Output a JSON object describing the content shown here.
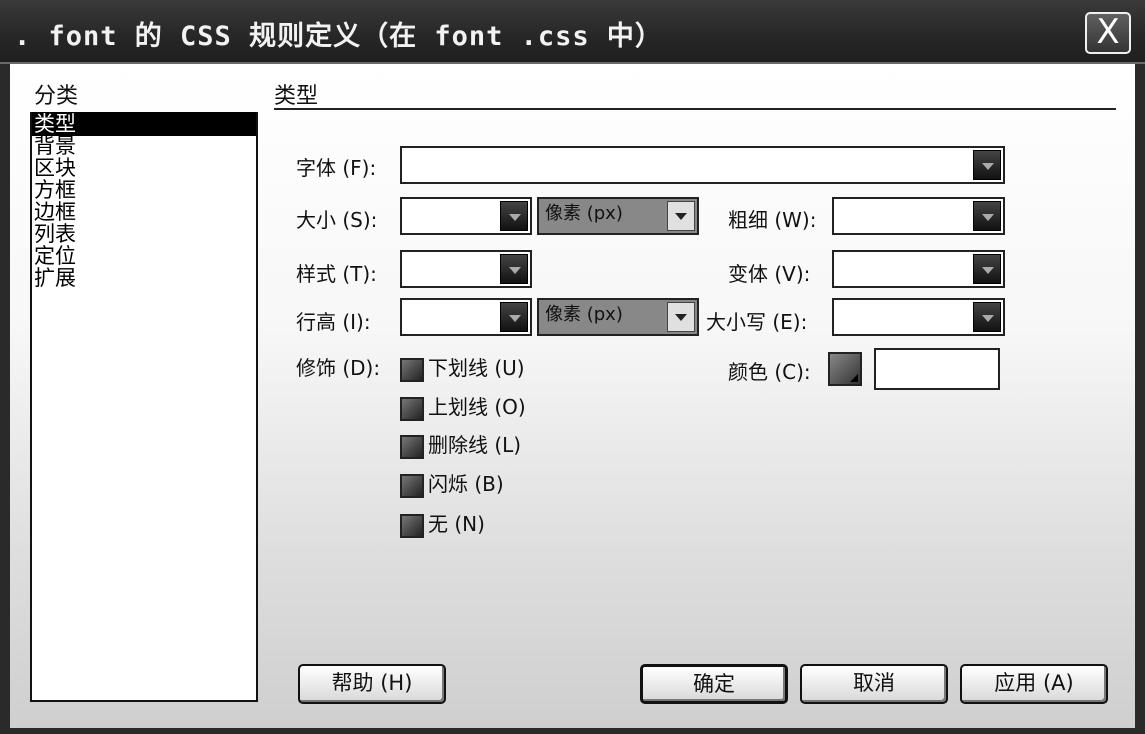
{
  "window": {
    "title": ". font 的 CSS 规则定义（在 font .css 中）",
    "close_label": "X"
  },
  "category": {
    "label": "分类",
    "items": [
      "类型",
      "背景",
      "区块",
      "方框",
      "边框",
      "列表",
      "定位",
      "扩展"
    ],
    "selected": "类型"
  },
  "section": {
    "title": "类型"
  },
  "fields": {
    "font": {
      "label": "字体 (F):",
      "value": ""
    },
    "size": {
      "label": "大小 (S):",
      "value": "",
      "unit": "像素 (px)"
    },
    "weight": {
      "label": "粗细 (W):",
      "value": ""
    },
    "style": {
      "label": "样式 (T):",
      "value": ""
    },
    "variant": {
      "label": "变体 (V):",
      "value": ""
    },
    "line_height": {
      "label": "行高 (I):",
      "value": "",
      "unit": "像素 (px)"
    },
    "case": {
      "label": "大小写 (E):",
      "value": ""
    },
    "decoration": {
      "label": "修饰 (D):"
    },
    "color": {
      "label": "颜色 (C):",
      "value": ""
    }
  },
  "decorations": [
    {
      "label": "下划线 (U)",
      "checked": false
    },
    {
      "label": "上划线 (O)",
      "checked": false
    },
    {
      "label": "删除线 (L)",
      "checked": false
    },
    {
      "label": "闪烁 (B)",
      "checked": false
    },
    {
      "label": "无 (N)",
      "checked": false
    }
  ],
  "buttons": {
    "help": "帮助 (H)",
    "ok": "确定",
    "cancel": "取消",
    "apply": "应用 (A)"
  }
}
